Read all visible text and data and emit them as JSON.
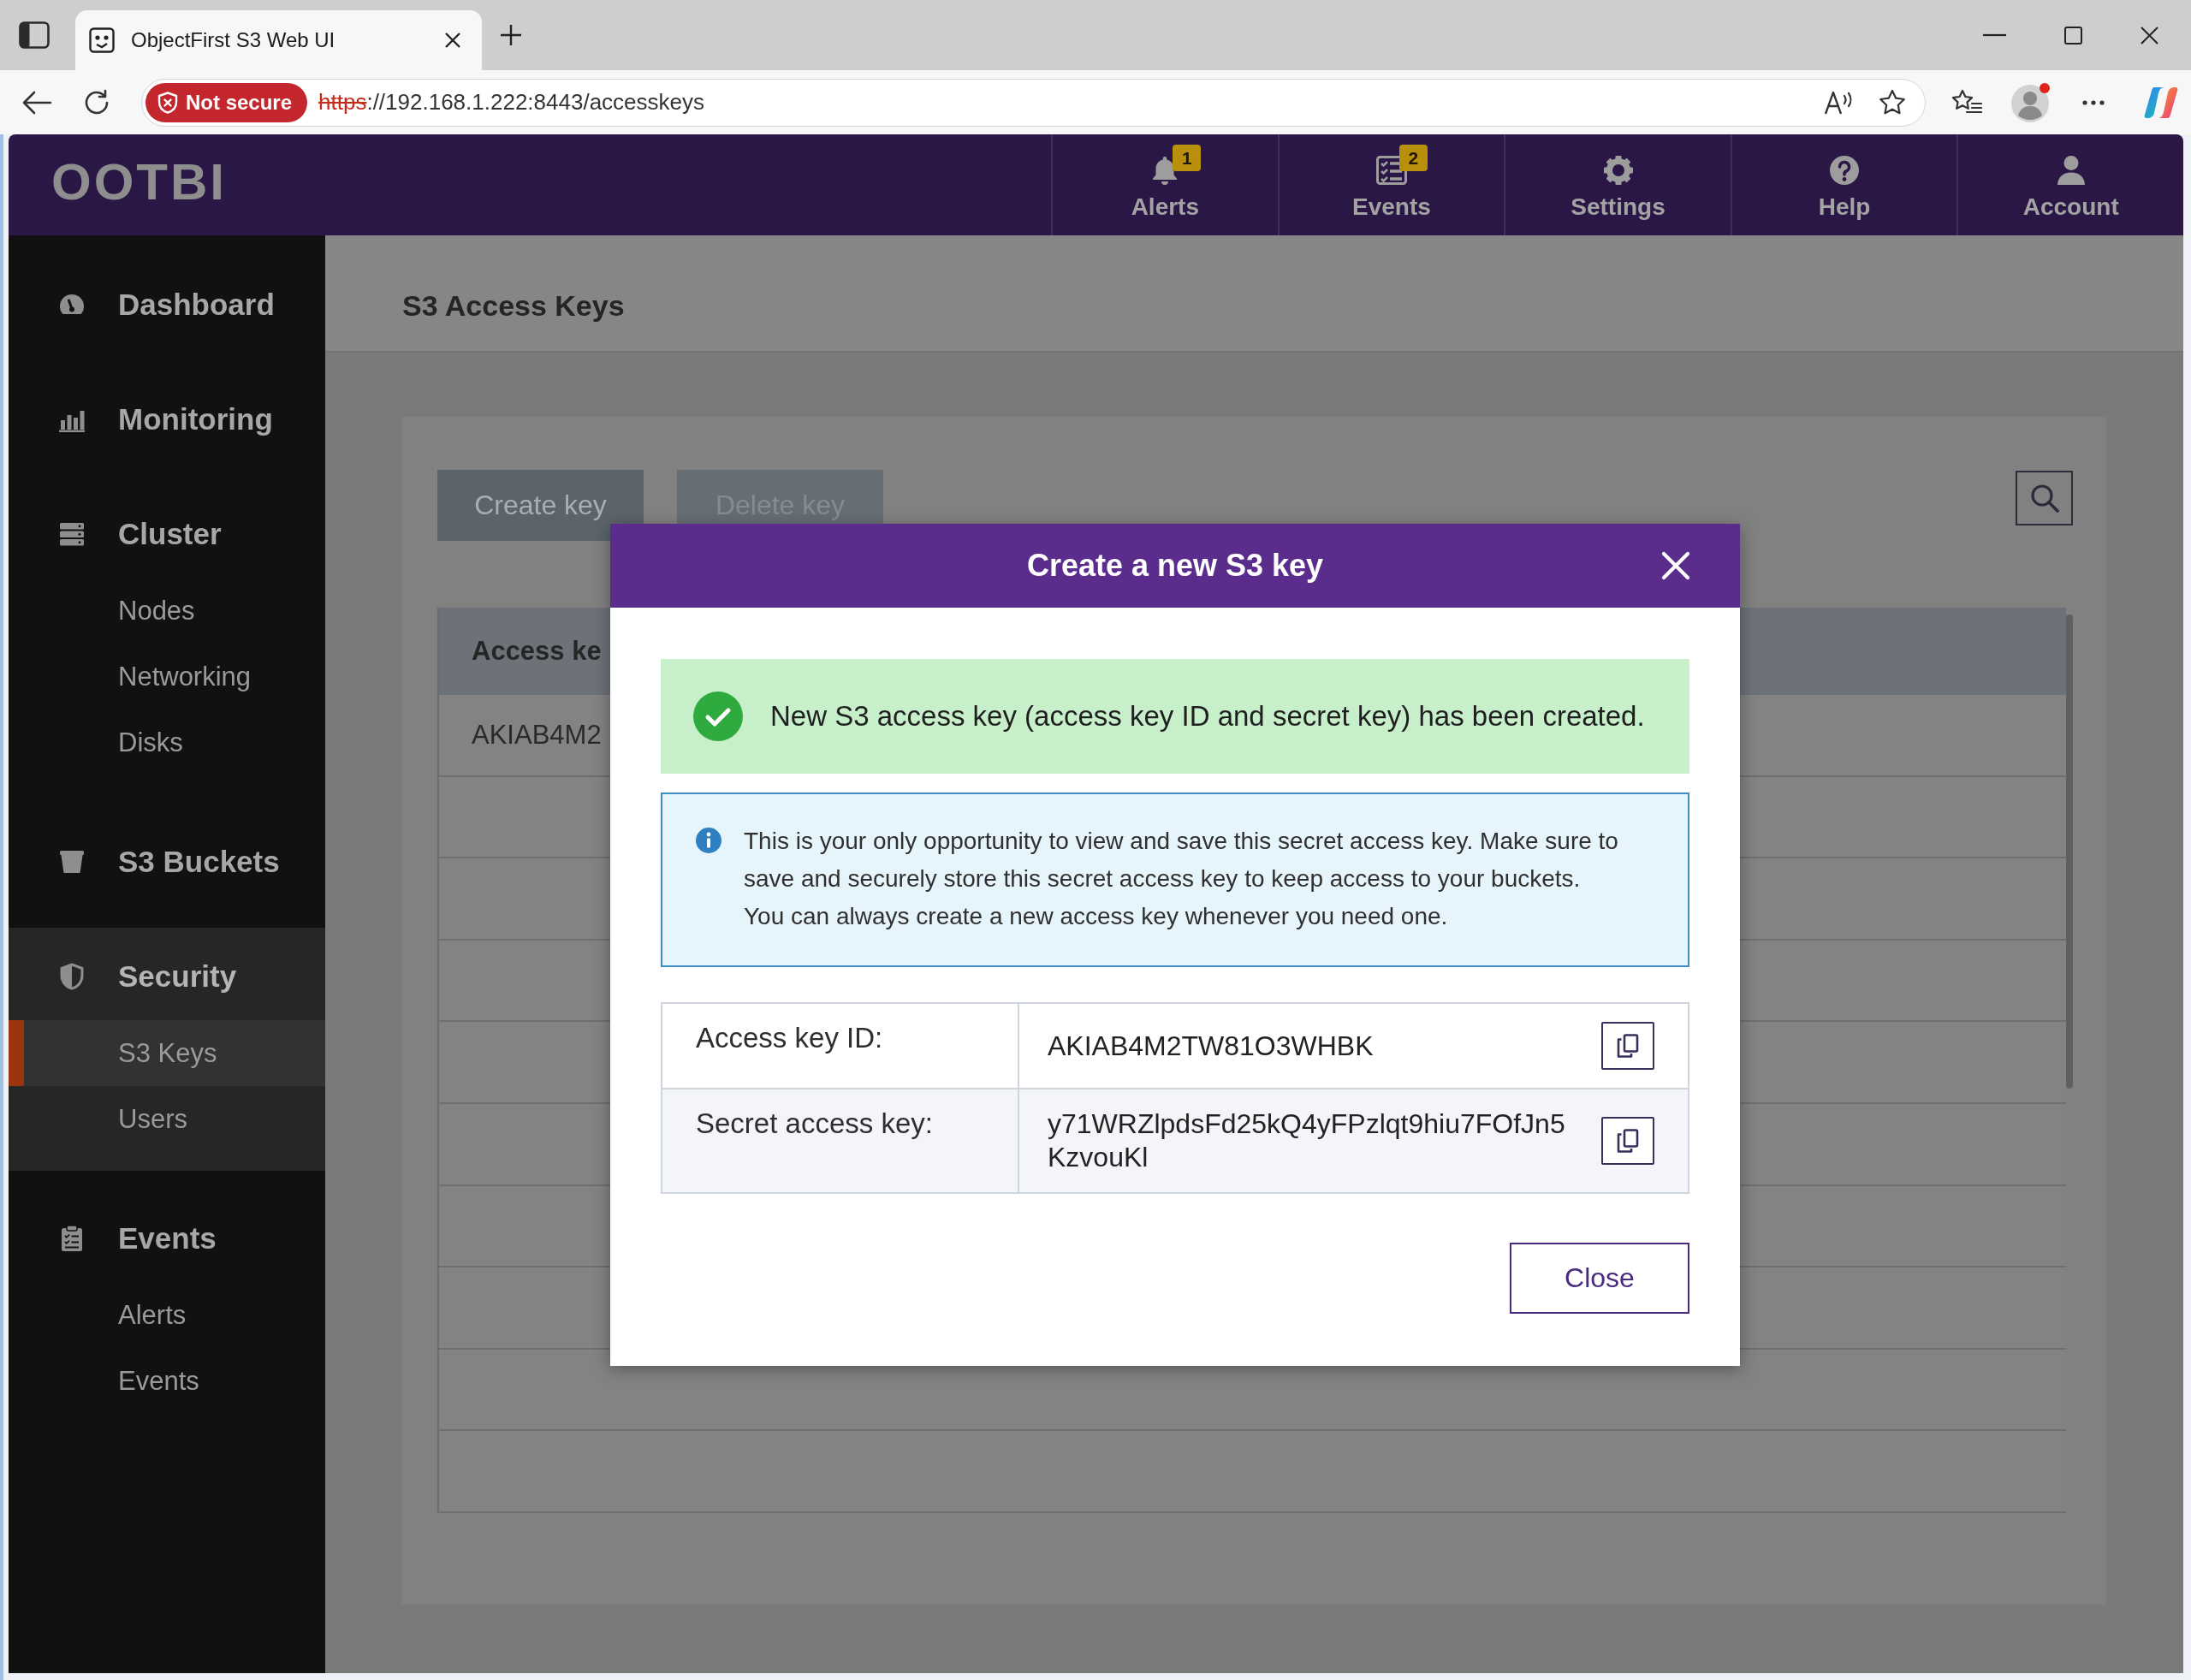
{
  "browser": {
    "tab": {
      "title": "ObjectFirst S3 Web UI"
    },
    "address_bar": {
      "security_badge": "Not secure",
      "url_scheme": "https",
      "url_rest": "://192.168.1.222:8443/accesskeys"
    }
  },
  "header": {
    "logo": "OOTBI",
    "nav": [
      {
        "label": "Alerts",
        "badge": "1"
      },
      {
        "label": "Events",
        "badge": "2"
      },
      {
        "label": "Settings"
      },
      {
        "label": "Help"
      },
      {
        "label": "Account"
      }
    ]
  },
  "sidebar": {
    "sections": [
      {
        "label": "Dashboard",
        "selected": false
      },
      {
        "label": "Monitoring",
        "selected": false
      },
      {
        "label": "Cluster",
        "selected": false,
        "children": [
          {
            "label": "Nodes",
            "selected": false
          },
          {
            "label": "Networking",
            "selected": false
          },
          {
            "label": "Disks",
            "selected": false
          }
        ]
      },
      {
        "label": "S3 Buckets",
        "selected": false
      },
      {
        "label": "Security",
        "selected": true,
        "children": [
          {
            "label": "S3 Keys",
            "selected": true
          },
          {
            "label": "Users",
            "selected": false
          }
        ]
      },
      {
        "label": "Events",
        "selected": false,
        "children": [
          {
            "label": "Alerts",
            "selected": false
          },
          {
            "label": "Events",
            "selected": false
          }
        ]
      }
    ]
  },
  "page": {
    "title": "S3 Access Keys",
    "actions": [
      {
        "label": "Create key",
        "disabled": false
      },
      {
        "label": "Delete key",
        "disabled": true
      }
    ],
    "table": {
      "columns": [
        "Access ke"
      ],
      "rows": [
        [
          "AKIAB4M2"
        ]
      ]
    }
  },
  "modal": {
    "title": "Create a new S3 key",
    "success_message": "New S3 access key (access key ID and secret key) has been created.",
    "info_message": "This is your only opportunity to view and save this secret access key. Make sure to save and securely store this secret access key to keep access to your buckets.\nYou can always create a new access key whenever you need one.",
    "fields": [
      {
        "label": "Access key ID:",
        "value": "AKIAB4M2TW81O3WHBK"
      },
      {
        "label": "Secret access key:",
        "value": "y71WRZlpdsFd25kQ4yFPzlqt9hiu7FOfJn5KzvouKl"
      }
    ],
    "close_button": "Close"
  }
}
